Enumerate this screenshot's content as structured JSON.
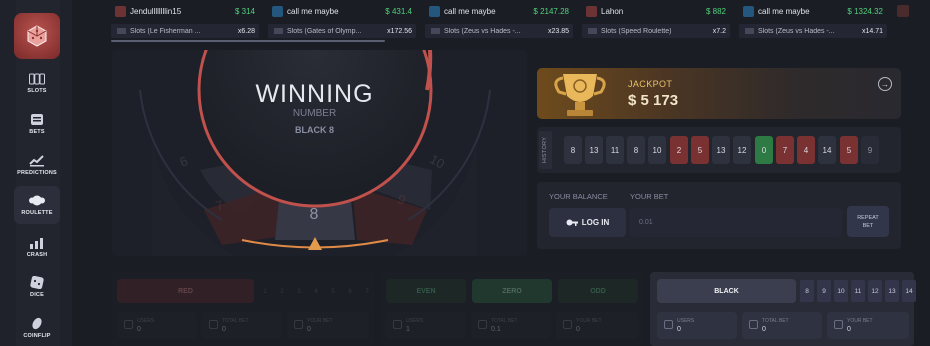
{
  "sidebar": {
    "items": [
      {
        "label": "SLOTS",
        "icon": "slots-icon"
      },
      {
        "label": "BETS",
        "icon": "bets-icon"
      },
      {
        "label": "PREDICTIONS",
        "icon": "predictions-icon"
      },
      {
        "label": "ROULETTE",
        "icon": "roulette-icon"
      },
      {
        "label": "CRASH",
        "icon": "crash-icon"
      },
      {
        "label": "DICE",
        "icon": "dice-icon"
      },
      {
        "label": "COINFLIP",
        "icon": "coinflip-icon"
      }
    ],
    "active": "ROULETTE"
  },
  "ticker": [
    {
      "name": "Jendullllllllin15",
      "amount": "$ 314",
      "game": "Slots (Le Fisherman ...",
      "mult": "x6.28"
    },
    {
      "name": "call me maybe",
      "amount": "$ 431.4",
      "game": "Slots (Gates of Olymp...",
      "mult": "x172.56"
    },
    {
      "name": "call me maybe",
      "amount": "$ 2147.28",
      "game": "Slots (Zeus vs Hades -...",
      "mult": "x23.85"
    },
    {
      "name": "Lahon",
      "amount": "$ 882",
      "game": "Slots (Speed Roulette)",
      "mult": "x7.2"
    },
    {
      "name": "call me maybe",
      "amount": "$ 1324.32",
      "game": "Slots (Zeus vs Hades -...",
      "mult": "x14.71"
    }
  ],
  "wheel": {
    "title": "WINNING",
    "subtitle": "NUMBER",
    "result": "BLACK 8",
    "pointer_number": "8",
    "faint_numbers": [
      "6",
      "7",
      "9",
      "10"
    ]
  },
  "jackpot": {
    "label": "JACKPOT",
    "amount": "$ 5 173"
  },
  "history": {
    "label": "HISTORY",
    "values": [
      {
        "n": "8",
        "c": "black"
      },
      {
        "n": "13",
        "c": "black"
      },
      {
        "n": "11",
        "c": "black"
      },
      {
        "n": "8",
        "c": "black"
      },
      {
        "n": "10",
        "c": "black"
      },
      {
        "n": "2",
        "c": "red"
      },
      {
        "n": "5",
        "c": "red"
      },
      {
        "n": "13",
        "c": "black"
      },
      {
        "n": "12",
        "c": "black"
      },
      {
        "n": "0",
        "c": "green"
      },
      {
        "n": "7",
        "c": "red"
      },
      {
        "n": "4",
        "c": "red"
      },
      {
        "n": "14",
        "c": "black"
      },
      {
        "n": "5",
        "c": "red"
      },
      {
        "n": "9",
        "c": "black"
      }
    ]
  },
  "bet": {
    "balance_label": "YOUR BALANCE",
    "bet_label": "YOUR BET",
    "login_label": "LOG IN",
    "input_placeholder": "0.01",
    "repeat_line1": "REPEAT",
    "repeat_line2": "BET"
  },
  "panels": {
    "red": {
      "button": "RED",
      "numbers": [
        "1",
        "2",
        "3",
        "4",
        "5",
        "6",
        "7"
      ],
      "users_label": "USERS",
      "users": "0",
      "total_label": "TOTAL BET",
      "total": "0",
      "yours_label": "YOUR BET",
      "yours": "0"
    },
    "green": {
      "even": "EVEN",
      "zero": "ZERO",
      "odd": "ODD",
      "users_label": "USERS",
      "users": "1",
      "total_label": "TOTAL BET",
      "total": "0.1",
      "yours_label": "YOUR BET",
      "yours": "0"
    },
    "black": {
      "button": "BLACK",
      "numbers": [
        "8",
        "9",
        "10",
        "11",
        "12",
        "13",
        "14"
      ],
      "users_label": "USERS",
      "users": "0",
      "total_label": "TOTAL BET",
      "total": "0",
      "yours_label": "YOUR BET",
      "yours": "0"
    }
  },
  "colors": {
    "accent_red": "#c0514c",
    "green_amount": "#4fd27b",
    "jackpot_gold": "#e7c16b"
  }
}
